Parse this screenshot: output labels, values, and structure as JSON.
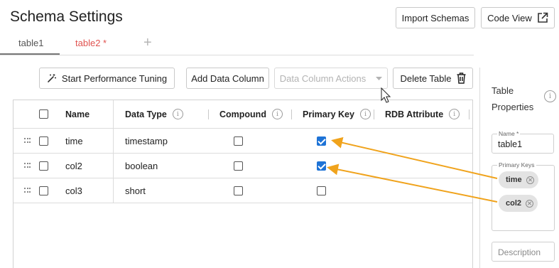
{
  "page": {
    "title": "Schema Settings"
  },
  "header": {
    "import_label": "Import Schemas",
    "code_view_label": "Code View"
  },
  "tabs": [
    {
      "label": "table1"
    },
    {
      "label": "table2 *"
    }
  ],
  "toolbar": {
    "tuning_label": "Start Performance Tuning",
    "add_column_label": "Add Data Column",
    "actions_label": "Data Column Actions",
    "delete_label": "Delete Table"
  },
  "table": {
    "columns": [
      "Name",
      "Data Type",
      "Compound",
      "Primary Key",
      "RDB Attribute"
    ],
    "rows": [
      {
        "name": "time",
        "type": "timestamp",
        "compound": false,
        "primary_key": true
      },
      {
        "name": "col2",
        "type": "boolean",
        "compound": false,
        "primary_key": true
      },
      {
        "name": "col3",
        "type": "short",
        "compound": false,
        "primary_key": false
      }
    ]
  },
  "side_panel": {
    "title_line1": "Table",
    "title_line2": "Properties",
    "name_label": "Name *",
    "name_value": "table1",
    "primary_keys_label": "Primary Keys",
    "primary_keys": [
      "time",
      "col2"
    ],
    "description_placeholder": "Description"
  },
  "colors": {
    "accent": "#1e73d6",
    "arrow": "#f0a31c",
    "tab_modified": "#e0524f"
  }
}
